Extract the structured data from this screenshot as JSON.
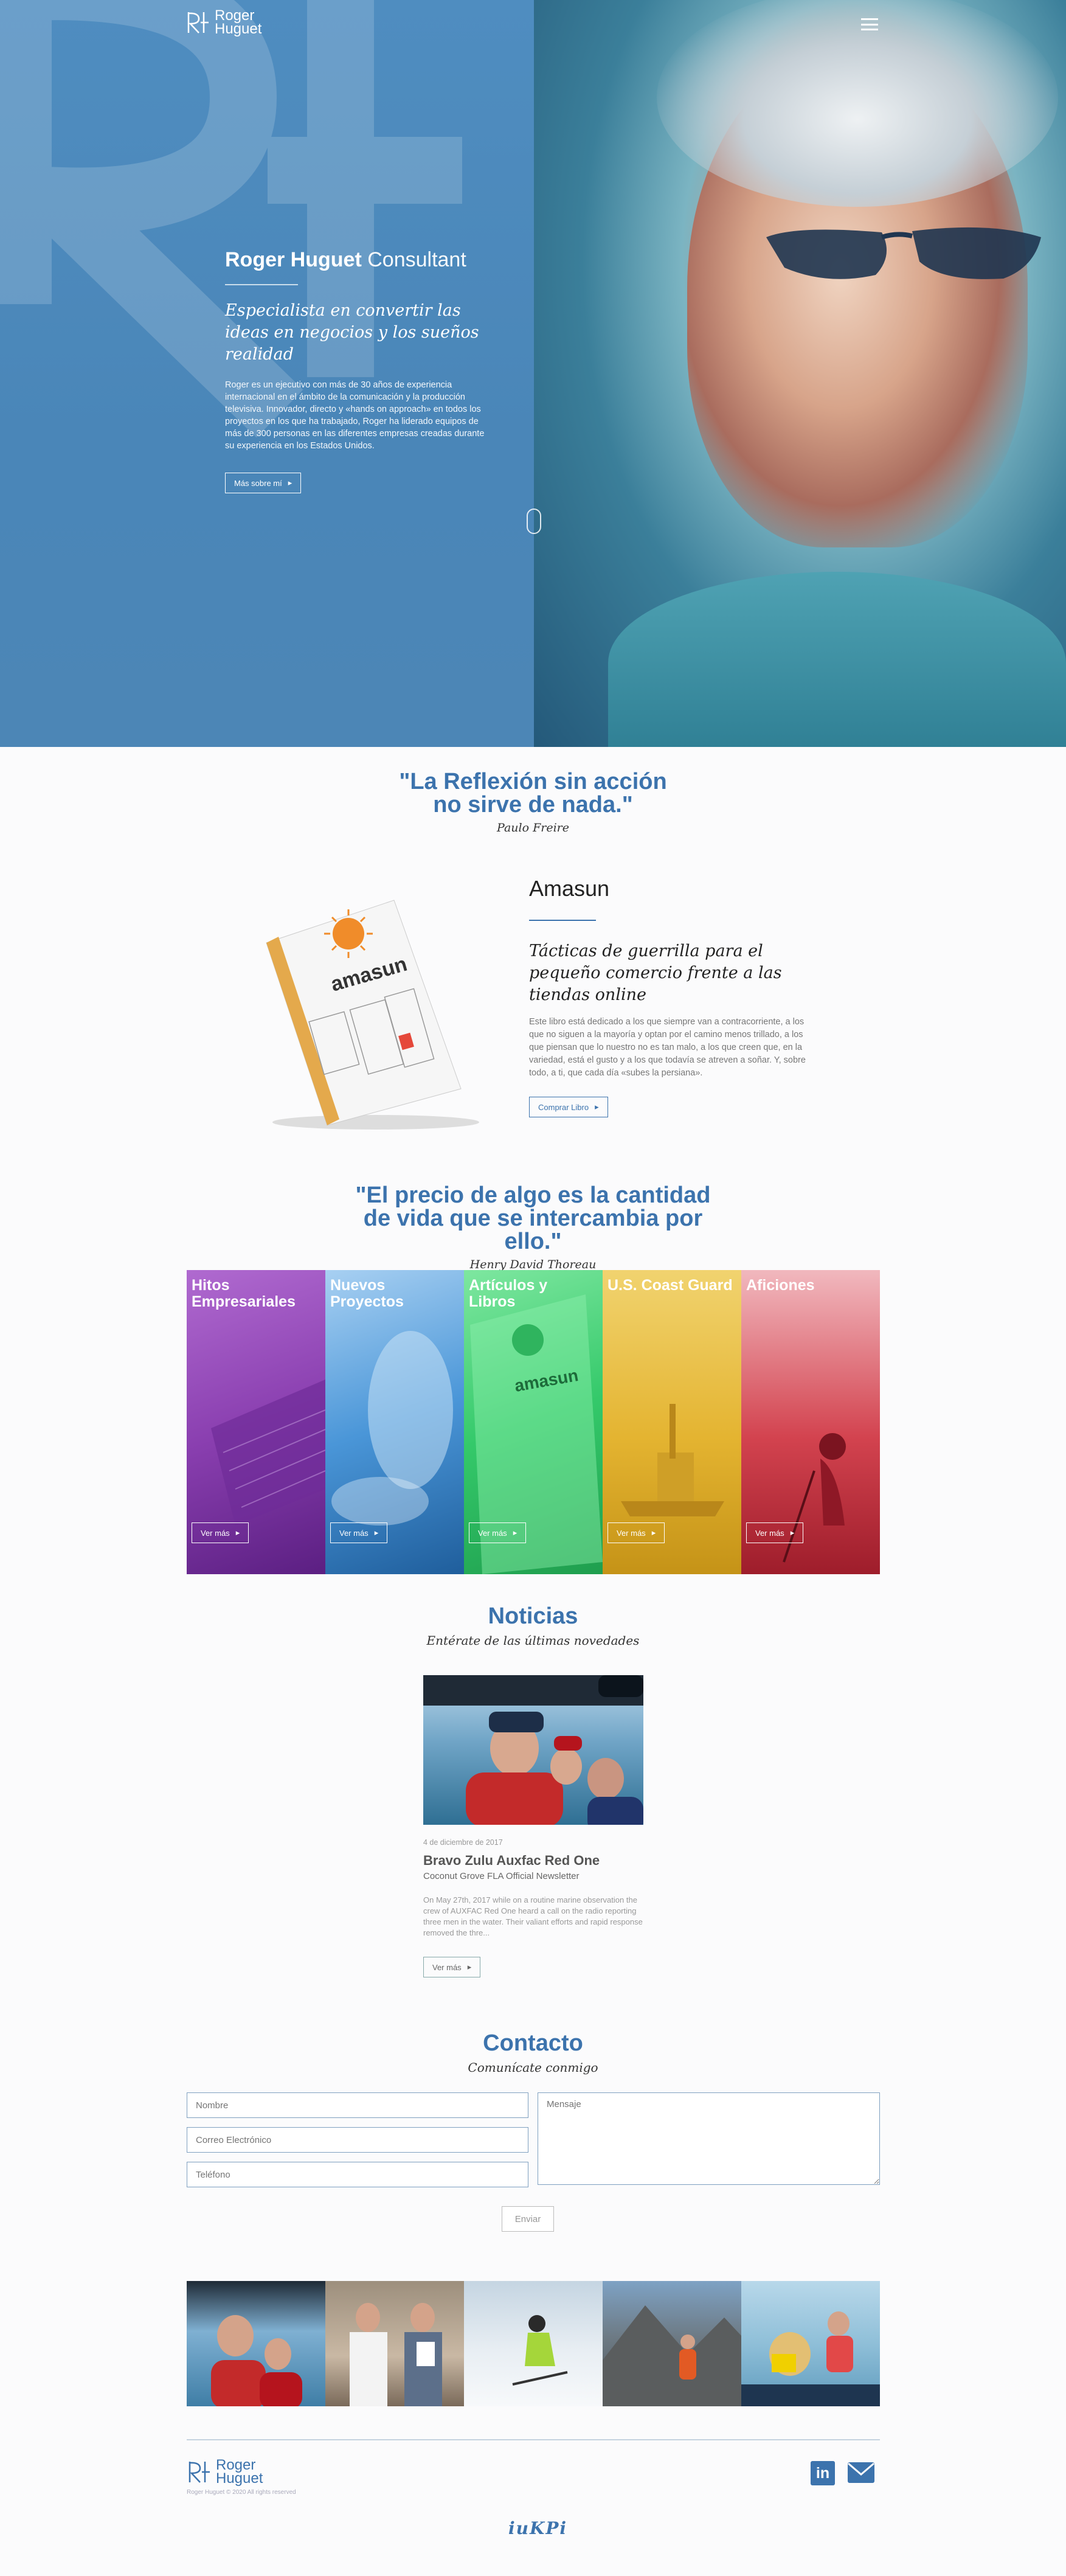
{
  "header": {
    "logo_line1": "Roger",
    "logo_line2": "Huguet",
    "logo_mark": "RH"
  },
  "hero": {
    "title_bold": "Roger Huguet",
    "title_light": "Consultant",
    "subtitle": "Especialista en convertir las ideas en negocios y los sueños realidad",
    "body": "Roger es un ejecutivo con más de 30 años de experiencia internacional en el ámbito de la comunicación y la producción televisiva. Innovador, directo y «hands on approach» en todos los proyectos en los que ha trabajado, Roger ha liderado equipos de más de 300 personas en las diferentes empresas creadas durante su experiencia en los Estados Unidos.",
    "button": "Más sobre mí"
  },
  "quote1": {
    "text": "\"La Reflexión sin acción no sirve de nada.\"",
    "author": "Paulo Freire"
  },
  "book": {
    "title": "Amasun",
    "subtitle": "Tácticas de guerrilla para el pequeño comercio frente a las tiendas online",
    "body": "Este libro está dedicado a los que siempre van a contracorriente, a los que no siguen a la mayoría y optan por el camino menos trillado, a los que piensan que lo nuestro no es tan malo, a los que creen que, en la variedad, está el gusto y a los que todavía se atreven a soñar. Y, sobre todo, a ti, que cada día «subes la persiana».",
    "button": "Comprar Libro",
    "cover_title": "amasun"
  },
  "quote2": {
    "text": "\"El precio de algo es la cantidad de vida que se intercambia por ello.\"",
    "author": "Henry David Thoreau"
  },
  "tiles": [
    {
      "label": "Hitos Empresariales",
      "button": "Ver más",
      "color": "#8a3fb0"
    },
    {
      "label": "Nuevos Proyectos",
      "button": "Ver más",
      "color": "#4a96d8"
    },
    {
      "label": "Artículos y Libros",
      "button": "Ver más",
      "color": "#34c96a"
    },
    {
      "label": "U.S. Coast Guard",
      "button": "Ver más",
      "color": "#e4b431"
    },
    {
      "label": "Aficiones",
      "button": "Ver más",
      "color": "#d3434f"
    }
  ],
  "news": {
    "heading": "Noticias",
    "subheading": "Entérate de las últimas novedades",
    "date": "4 de diciembre de 2017",
    "title": "Bravo Zulu Auxfac Red One",
    "source": "Coconut Grove FLA Official Newsletter",
    "body": "On May 27th, 2017 while on a routine marine observation the crew of AUXFAC Red One heard a call on the radio reporting three men in the water. Their valiant efforts and rapid response removed the thre...",
    "button": "Ver más"
  },
  "contact": {
    "heading": "Contacto",
    "subheading": "Comunícate conmigo",
    "name_placeholder": "Nombre",
    "email_placeholder": "Correo Electrónico",
    "phone_placeholder": "Teléfono",
    "message_placeholder": "Mensaje",
    "submit": "Enviar"
  },
  "footer": {
    "logo_line1": "Roger",
    "logo_line2": "Huguet",
    "copyright": "Roger Huguet © 2020 All rights reserved",
    "linkedin": "in",
    "signature": "iuKPi"
  },
  "colors": {
    "brand_blue": "#3c73ad",
    "hero_blue": "#4a86b8"
  }
}
